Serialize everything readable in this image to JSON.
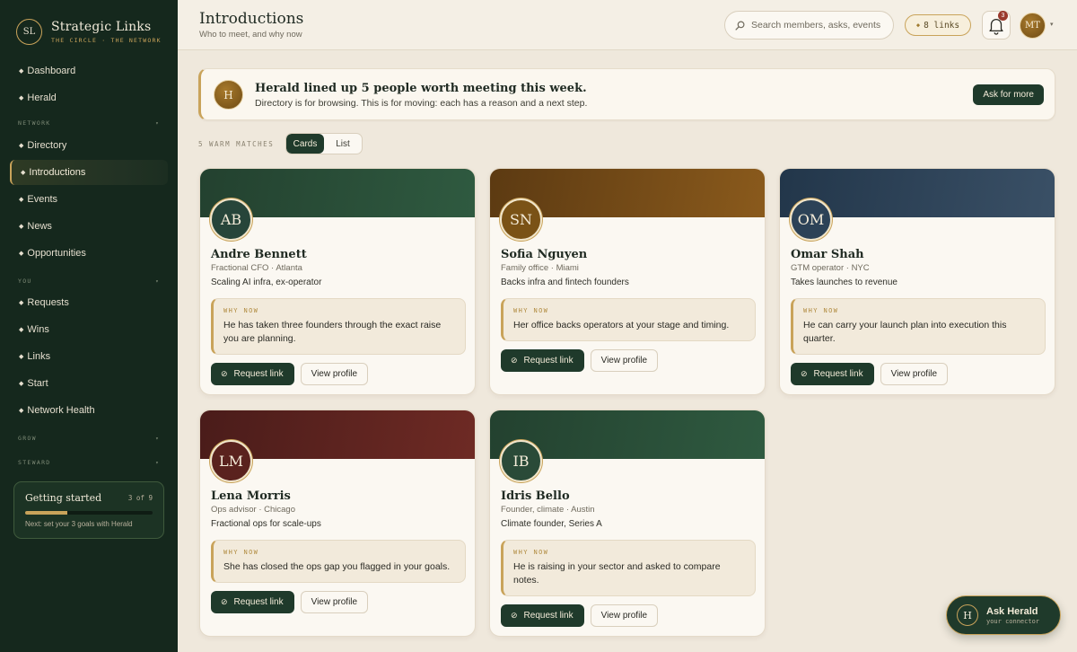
{
  "brand": {
    "initials": "SL",
    "name": "Strategic Links",
    "tagline": "THE CIRCLE · THE NETWORK"
  },
  "nav": {
    "top": [
      {
        "id": "dashboard",
        "label": "Dashboard"
      },
      {
        "id": "herald",
        "label": "Herald"
      }
    ],
    "sections": [
      {
        "id": "network",
        "label": "NETWORK",
        "items": [
          {
            "id": "directory",
            "label": "Directory"
          },
          {
            "id": "introductions",
            "label": "Introductions",
            "active": true
          },
          {
            "id": "events",
            "label": "Events"
          },
          {
            "id": "news",
            "label": "News"
          },
          {
            "id": "opportunities",
            "label": "Opportunities"
          }
        ]
      },
      {
        "id": "you",
        "label": "YOU",
        "items": [
          {
            "id": "requests",
            "label": "Requests"
          },
          {
            "id": "wins",
            "label": "Wins"
          },
          {
            "id": "links",
            "label": "Links"
          },
          {
            "id": "start",
            "label": "Start"
          },
          {
            "id": "network-health",
            "label": "Network Health"
          }
        ]
      },
      {
        "id": "grow",
        "label": "GROW",
        "items": []
      },
      {
        "id": "steward",
        "label": "STEWARD",
        "items": []
      }
    ]
  },
  "getting_started": {
    "title": "Getting started",
    "count": "3 of 9",
    "progress": 0.333,
    "next": "Next: set your 3 goals with Herald"
  },
  "topbar": {
    "title": "Introductions",
    "subtitle": "Who to meet, and why now",
    "search_placeholder": "Search members, asks, events",
    "links_label": "8 links",
    "notifications": "3",
    "user_initials": "MT"
  },
  "banner": {
    "initial": "H",
    "title": "Herald lined up 5 people worth meeting this week.",
    "subtitle": "Directory is for browsing. This is for moving: each has a reason and a next step.",
    "button": "Ask for more"
  },
  "view": {
    "matches_label": "5 WARM MATCHES",
    "options": [
      "Cards",
      "List"
    ],
    "selected": "Cards"
  },
  "card_labels": {
    "why_now": "WHY NOW",
    "request": "Request link",
    "view": "View profile"
  },
  "matches": [
    {
      "initials": "AB",
      "name": "Andre Bennett",
      "role": "Fractional CFO · Atlanta",
      "tagline": "Scaling AI infra, ex-operator",
      "why": "He has taken three founders through the exact raise you are planning.",
      "gradient": [
        "#23412f",
        "#2f5a40"
      ],
      "avatar": "#27453a"
    },
    {
      "initials": "SN",
      "name": "Sofia Nguyen",
      "role": "Family office · Miami",
      "tagline": "Backs infra and fintech founders",
      "why": "Her office backs operators at your stage and timing.",
      "gradient": [
        "#5c3a12",
        "#8a5a1c"
      ],
      "avatar": "#7a5216"
    },
    {
      "initials": "OM",
      "name": "Omar Shah",
      "role": "GTM operator · NYC",
      "tagline": "Takes launches to revenue",
      "why": "He can carry your launch plan into execution this quarter.",
      "gradient": [
        "#22364a",
        "#3a5066"
      ],
      "avatar": "#2c4257"
    },
    {
      "initials": "LM",
      "name": "Lena Morris",
      "role": "Ops advisor · Chicago",
      "tagline": "Fractional ops for scale-ups",
      "why": "She has closed the ops gap you flagged in your goals.",
      "gradient": [
        "#4a1c1a",
        "#6e2a24"
      ],
      "avatar": "#5a221e"
    },
    {
      "initials": "IB",
      "name": "Idris Bello",
      "role": "Founder, climate · Austin",
      "tagline": "Climate founder, Series A",
      "why": "He is raising in your sector and asked to compare notes.",
      "gradient": [
        "#23412f",
        "#2f5a40"
      ],
      "avatar": "#2a4a38"
    }
  ],
  "ask_herald": {
    "initial": "H",
    "title": "Ask Herald",
    "subtitle": "your connector"
  }
}
